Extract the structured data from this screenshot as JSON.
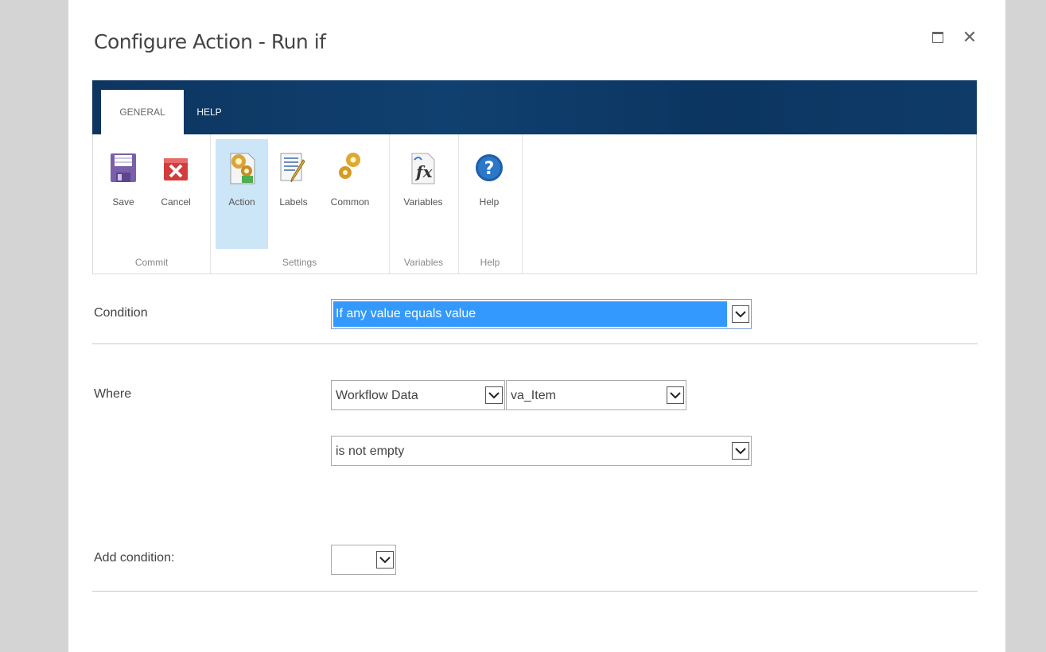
{
  "dialog": {
    "title": "Configure Action - Run if"
  },
  "ribbon": {
    "tabs": [
      {
        "label": "GENERAL",
        "active": true
      },
      {
        "label": "HELP",
        "active": false
      }
    ],
    "buttons": {
      "save": "Save",
      "cancel": "Cancel",
      "action": "Action",
      "labels": "Labels",
      "common": "Common",
      "variables": "Variables",
      "help": "Help"
    },
    "groups": {
      "commit": "Commit",
      "settings": "Settings",
      "variables": "Variables",
      "help": "Help"
    }
  },
  "form": {
    "condition_label": "Condition",
    "condition_value": "If any value equals value",
    "where_label": "Where",
    "where_source": "Workflow Data",
    "where_field": "va_Item",
    "where_operator": "is not empty",
    "add_condition_label": "Add condition:",
    "add_condition_value": ""
  },
  "colors": {
    "ribbon_bar": "#0e3763",
    "selected_button": "#cde6f7",
    "highlight": "#3399ff"
  }
}
